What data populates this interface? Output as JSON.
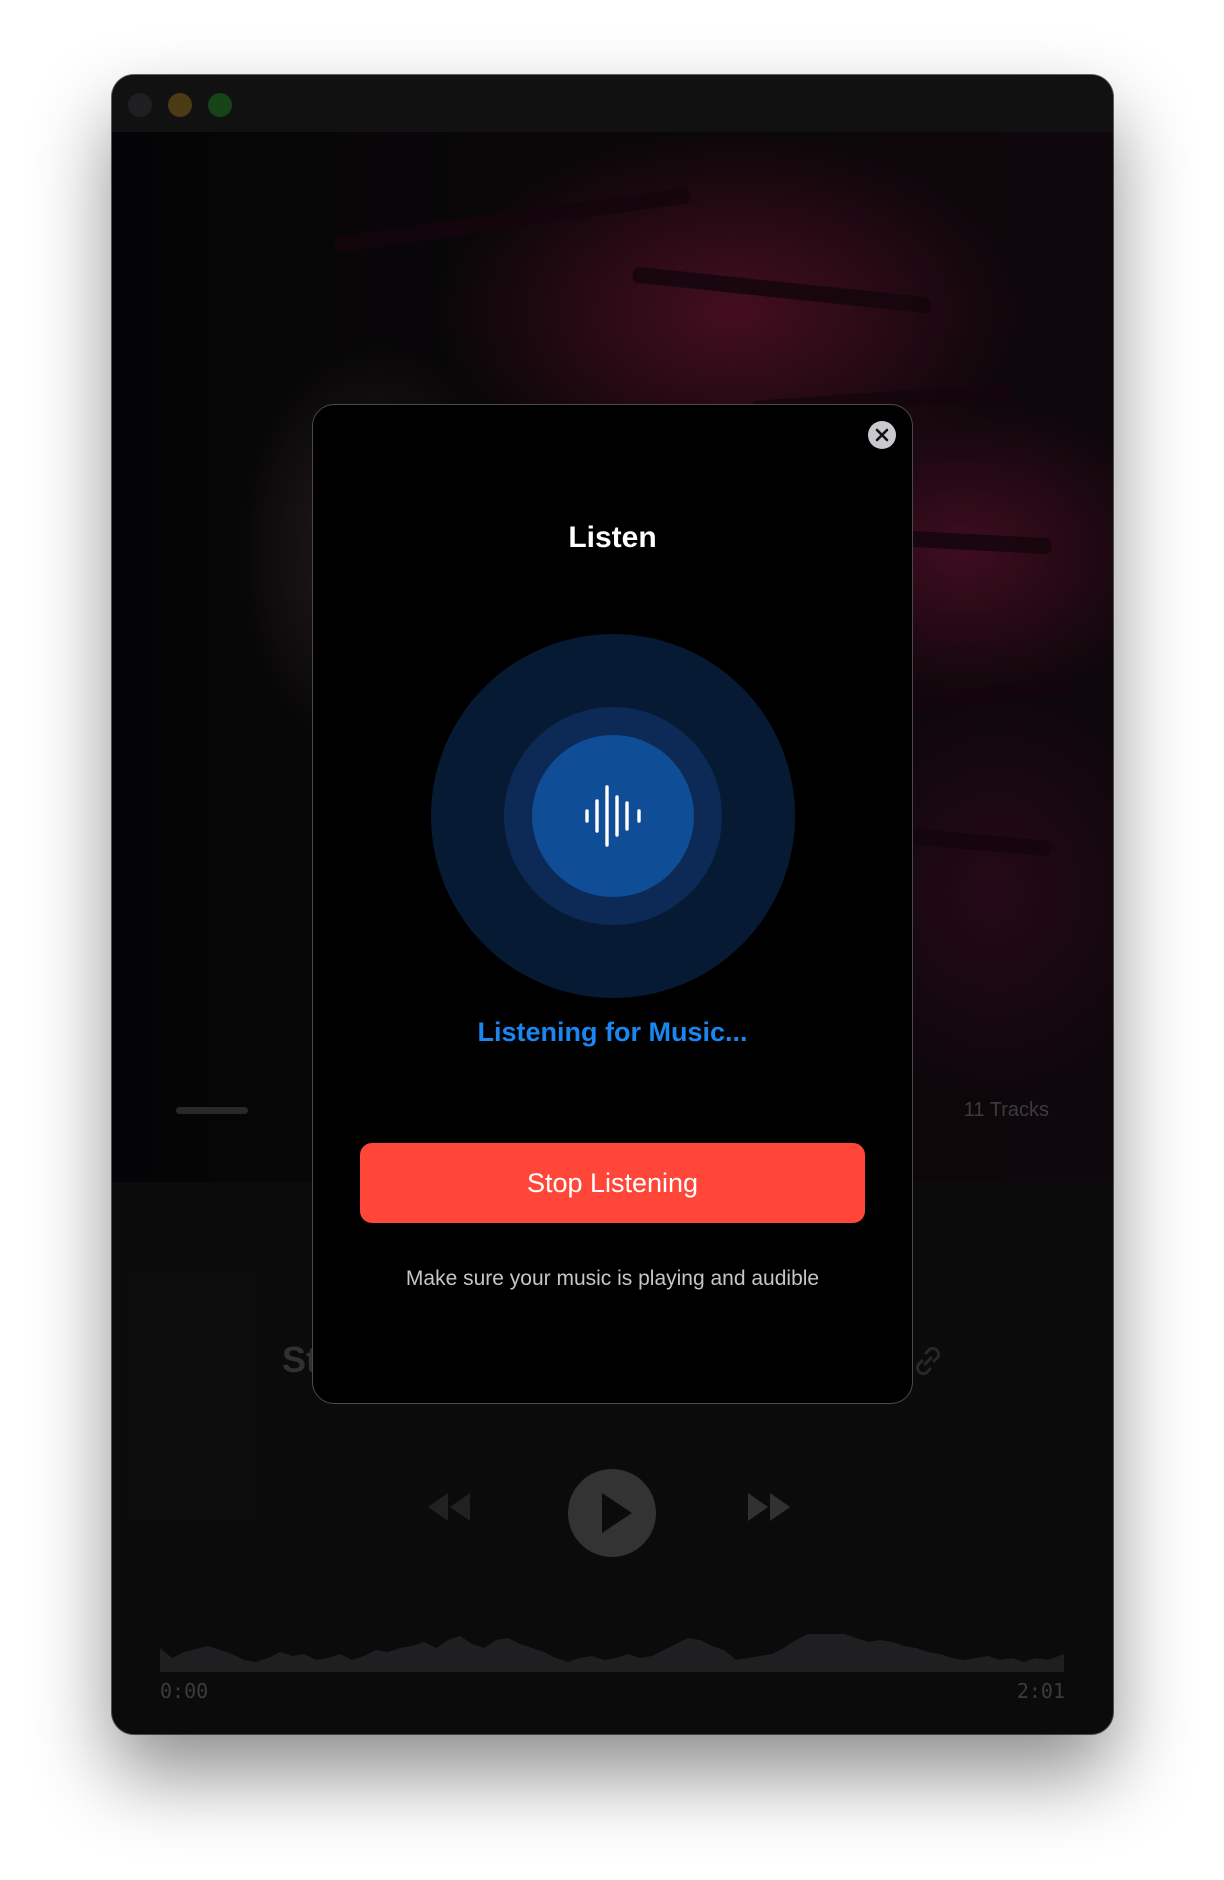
{
  "window": {
    "traffic_lights": [
      "close",
      "minimize",
      "maximize"
    ]
  },
  "player": {
    "tracks_label": "11 Tracks",
    "song_title_partial": "St",
    "time_start": "0:00",
    "time_end": "2:01"
  },
  "modal": {
    "title": "Listen",
    "status": "Listening for Music...",
    "stop_button": "Stop Listening",
    "hint": "Make sure your music is playing and audible"
  },
  "icons": {
    "close": "close-icon",
    "waveform": "waveform-icon",
    "rewind": "rewind-icon",
    "play": "play-icon",
    "forward": "fast-forward-icon",
    "link": "link-icon"
  },
  "colors": {
    "accent_blue": "#1a86f0",
    "stop_red": "#ff4638",
    "modal_bg": "#000000"
  }
}
